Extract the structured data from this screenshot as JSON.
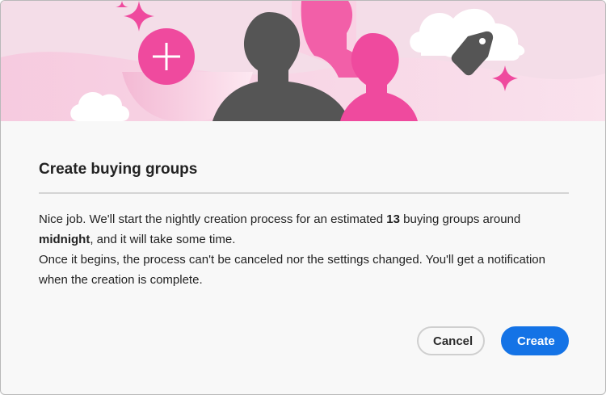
{
  "dialog": {
    "title": "Create buying groups",
    "message": {
      "line1_pre": "Nice job. We'll start the nightly creation process for an estimated ",
      "count": "13",
      "line1_mid": " buying groups around ",
      "time": "midnight",
      "line1_post": ", and it will take some time.",
      "line2": "Once it begins, the process can't be canceled nor the settings changed. You'll get a notification when the creation is complete."
    },
    "buttons": {
      "cancel_label": "Cancel",
      "create_label": "Create"
    }
  },
  "colors": {
    "accent": "#1473e6",
    "illustration_pink": "#ef4a9e",
    "illustration_gray": "#555555",
    "hero_background": "#f4dde8"
  },
  "illustration": {
    "icons": [
      "plus-circle-icon",
      "tag-icon",
      "sparkle-icon",
      "cloud-icon",
      "person-silhouette-icon"
    ]
  }
}
